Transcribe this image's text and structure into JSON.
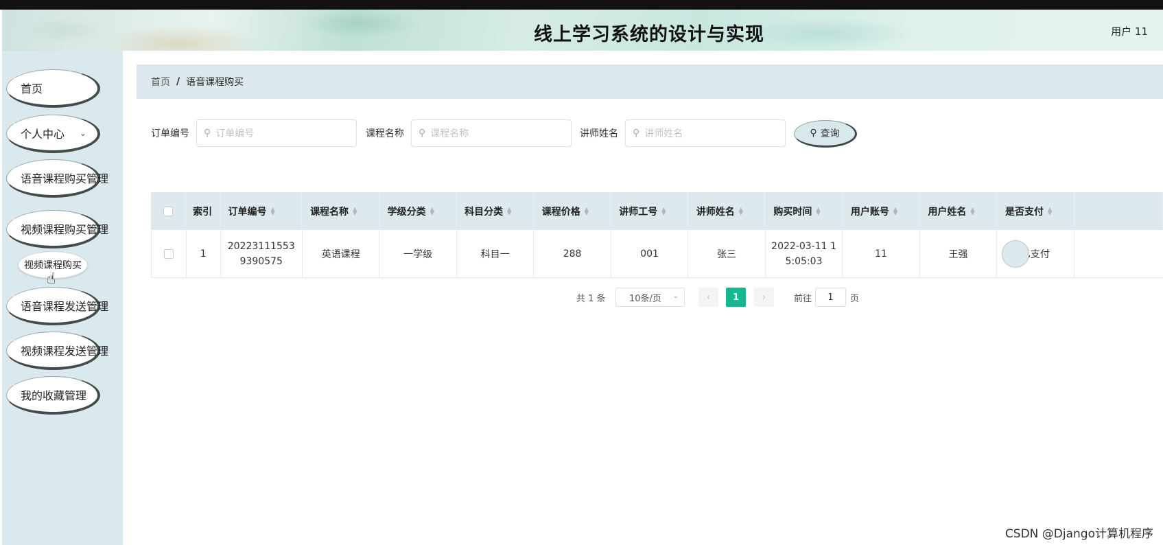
{
  "header": {
    "title": "线上学习系统的设计与实现",
    "user": "用户 11"
  },
  "sidebar": {
    "items": [
      {
        "label": "首页"
      },
      {
        "label": "个人中心",
        "chevron": "⌄"
      },
      {
        "label": "语音课程购买管理"
      },
      {
        "label": "视频课程购买管理"
      },
      {
        "label": "语音课程发送管理"
      },
      {
        "label": "视频课程发送管理"
      },
      {
        "label": "我的收藏管理"
      }
    ],
    "active_sub": "视频课程购买"
  },
  "breadcrumb": {
    "home": "首页",
    "separator": "/",
    "current": "语音课程购买"
  },
  "search": {
    "order_label": "订单编号",
    "order_placeholder": "订单编号",
    "course_label": "课程名称",
    "course_placeholder": "课程名称",
    "teacher_label": "讲师姓名",
    "teacher_placeholder": "讲师姓名",
    "query_label": "查询"
  },
  "table": {
    "headers": {
      "index": "索引",
      "order_no": "订单编号",
      "course_name": "课程名称",
      "grade": "学级分类",
      "subject": "科目分类",
      "price": "课程价格",
      "teacher_no": "讲师工号",
      "teacher_name": "讲师姓名",
      "buy_time": "购买时间",
      "user_account": "用户账号",
      "user_name": "用户姓名",
      "paid": "是否支付"
    },
    "rows": [
      {
        "index": "1",
        "order_no": "20223111553\n9390575",
        "course_name": "英语课程",
        "grade": "一学级",
        "subject": "科目一",
        "price": "288",
        "teacher_no": "001",
        "teacher_name": "张三",
        "buy_time": "2022-03-11 1\n5:05:03",
        "user_account": "11",
        "user_name": "王强",
        "paid": "已支付"
      }
    ]
  },
  "pagination": {
    "total": "共 1 条",
    "page_size": "10条/页",
    "current_page": "1",
    "goto_label": "前往",
    "goto_value": "1",
    "page_suffix": "页"
  },
  "watermark": "CSDN @Django计算机程序",
  "colors": {
    "accent": "#14b891",
    "sidebar_bg": "#d9e9ed",
    "header_row_bg": "#dde9ed"
  }
}
